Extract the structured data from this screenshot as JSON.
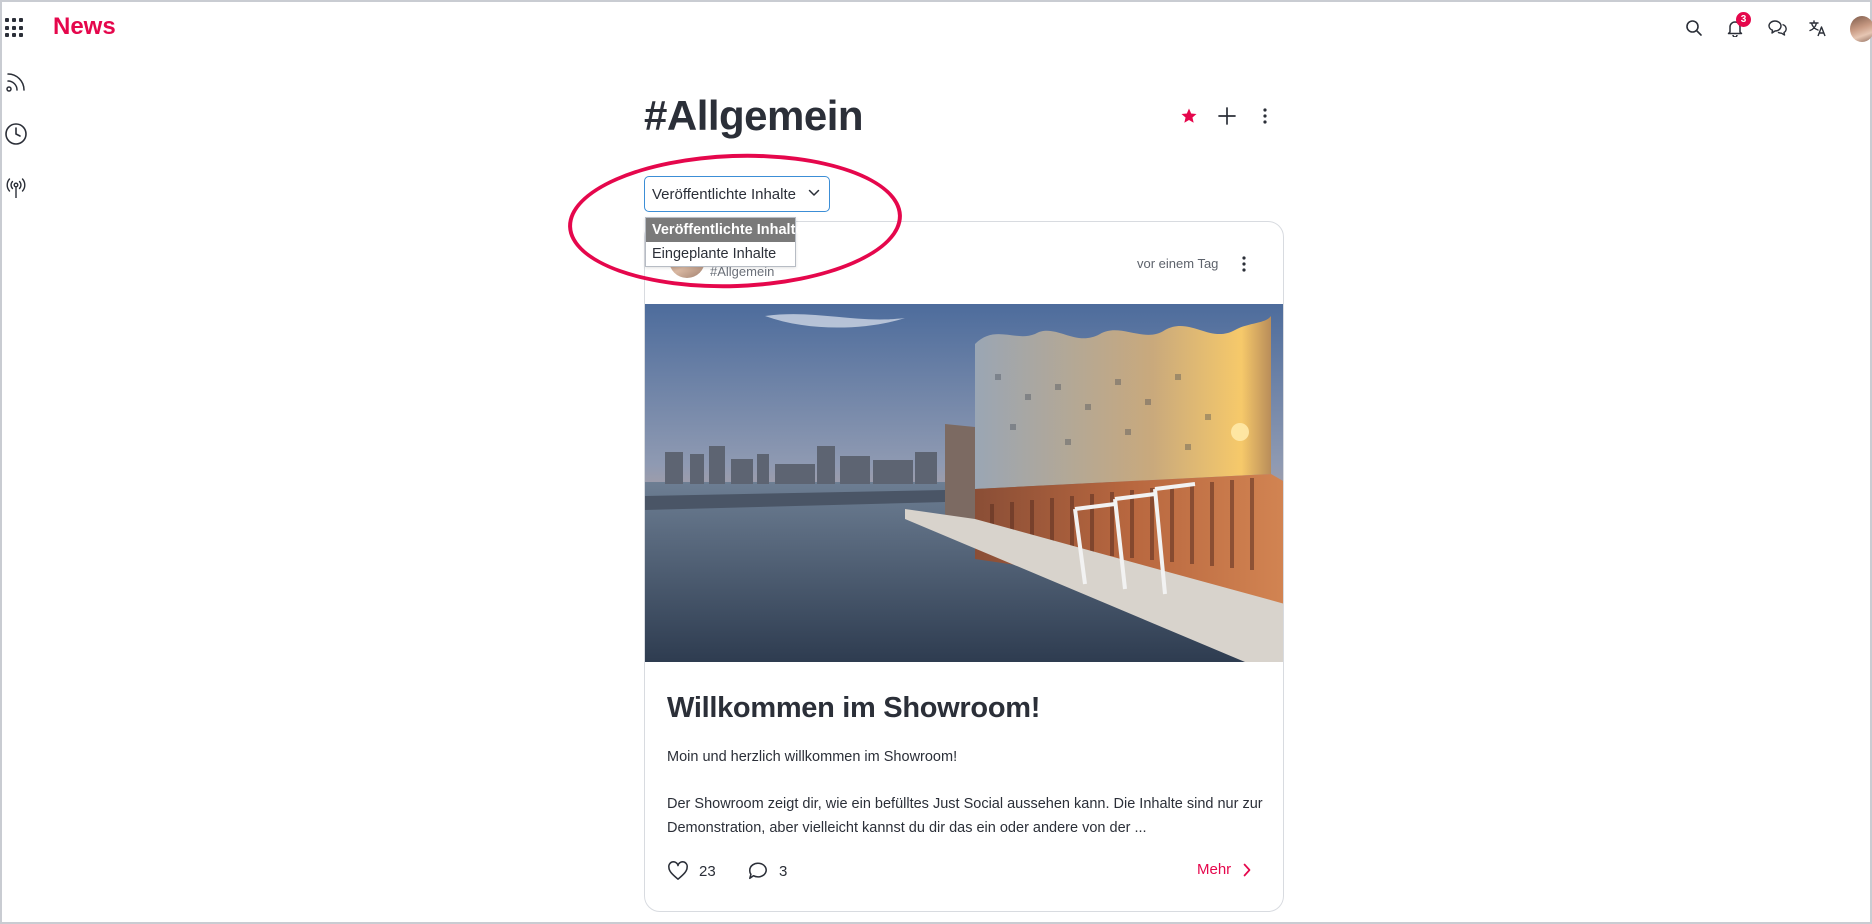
{
  "app": {
    "title": "News"
  },
  "topbar": {
    "notifications_count": "3",
    "icons": [
      "apps-grid-icon",
      "search-icon",
      "bell-icon",
      "chat-icon",
      "translate-icon",
      "user-avatar"
    ]
  },
  "rail": {
    "icons": [
      "rss-feed-icon",
      "clock-icon",
      "broadcast-icon"
    ]
  },
  "channel": {
    "title": "#Allgemein",
    "favorite": true
  },
  "filter": {
    "selected": "Veröffentlichte Inhalte",
    "options": [
      "Veröffentlichte Inhalte",
      "Eingeplante Inhalte"
    ]
  },
  "post": {
    "channel_tag": "#Allgemein",
    "time": "vor einem Tag",
    "title": "Willkommen im Showroom!",
    "paragraph1": "Moin und herzlich willkommen im Showroom!",
    "paragraph2": "Der Showroom zeigt dir, wie ein befülltes Just Social aussehen kann. Die Inhalte sind nur zur Demonstration, aber vielleicht kannst du dir das ein oder andere von der ...",
    "likes": "23",
    "comments": "3",
    "more_label": "Mehr"
  },
  "colors": {
    "accent": "#e5074c",
    "text": "#2b2f38",
    "focus": "#3c8ed6"
  }
}
